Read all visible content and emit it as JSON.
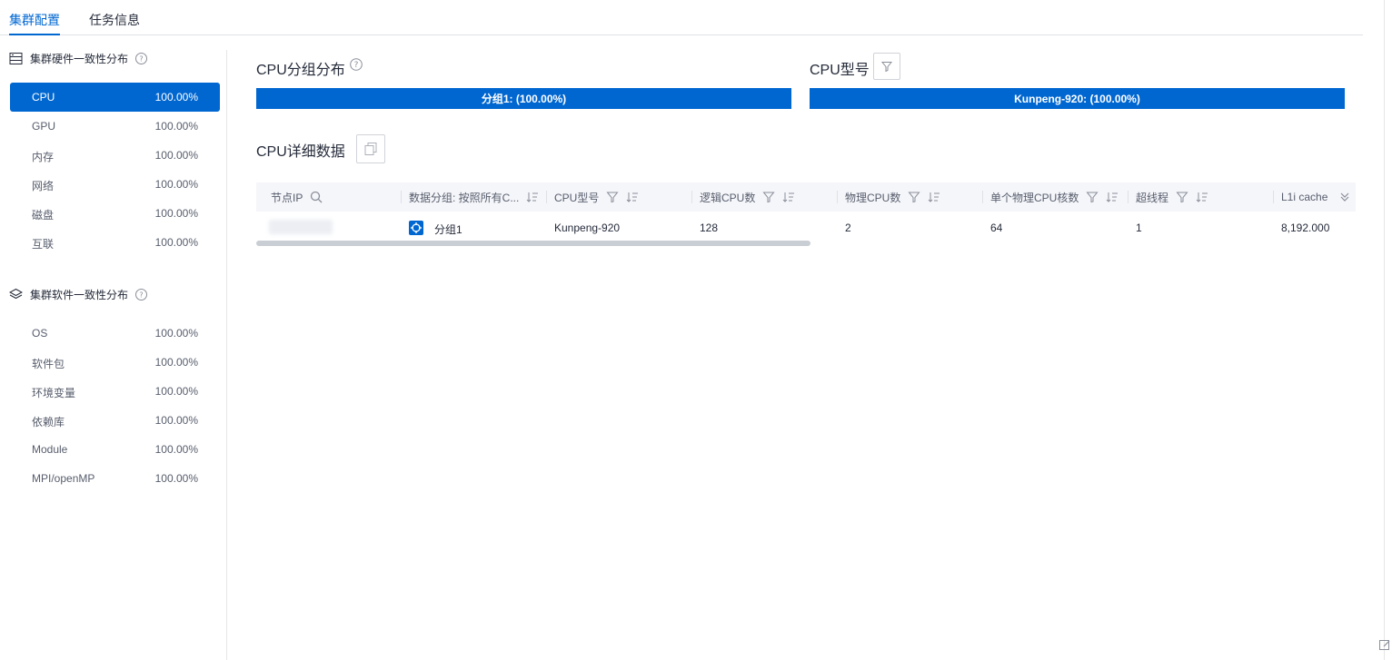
{
  "tabs": [
    {
      "label": "集群配置",
      "active": true
    },
    {
      "label": "任务信息",
      "active": false
    }
  ],
  "sidebar": {
    "hardware": {
      "title": "集群硬件一致性分布",
      "items": [
        {
          "name": "CPU",
          "percent": "100.00%",
          "active": true
        },
        {
          "name": "GPU",
          "percent": "100.00%"
        },
        {
          "name": "内存",
          "percent": "100.00%"
        },
        {
          "name": "网络",
          "percent": "100.00%"
        },
        {
          "name": "磁盘",
          "percent": "100.00%"
        },
        {
          "name": "互联",
          "percent": "100.00%"
        }
      ]
    },
    "software": {
      "title": "集群软件一致性分布",
      "items": [
        {
          "name": "OS",
          "percent": "100.00%"
        },
        {
          "name": "软件包",
          "percent": "100.00%"
        },
        {
          "name": "环境变量",
          "percent": "100.00%"
        },
        {
          "name": "依赖库",
          "percent": "100.00%"
        },
        {
          "name": "Module",
          "percent": "100.00%"
        },
        {
          "name": "MPI/openMP",
          "percent": "100.00%"
        }
      ]
    }
  },
  "main": {
    "group_dist": {
      "title": "CPU分组分布",
      "bar_label": "分组1: (100.00%)",
      "fraction": 1.0
    },
    "model": {
      "title": "CPU型号",
      "bar_label": "Kunpeng-920: (100.00%)",
      "fraction": 1.0
    },
    "detail": {
      "title": "CPU详细数据"
    },
    "table": {
      "headers": [
        "节点IP",
        "数据分组: 按照所有C...",
        "CPU型号",
        "逻辑CPU数",
        "物理CPU数",
        "单个物理CPU核数",
        "超线程",
        "L1i cache"
      ],
      "rows": [
        {
          "ip": "",
          "group": "分组1",
          "model": "Kunpeng-920",
          "logical": "128",
          "physical": "2",
          "cores": "64",
          "ht": "1",
          "l1i": "8,192.000"
        }
      ]
    }
  },
  "colors": {
    "accent": "#0067d1",
    "header_bg": "#f5f6fa"
  }
}
